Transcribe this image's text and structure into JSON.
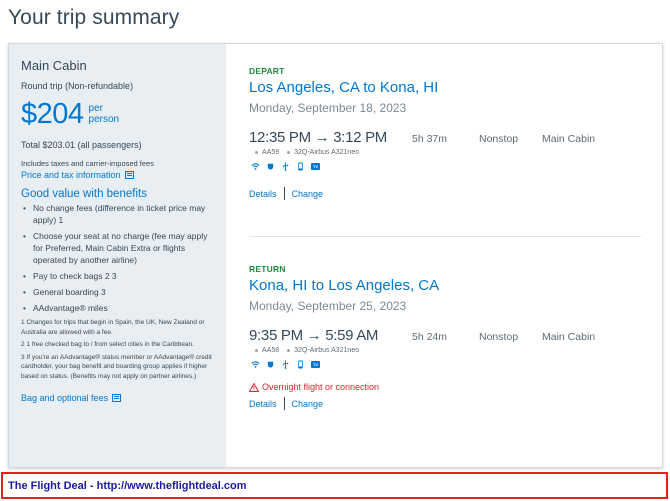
{
  "page": {
    "title": "Your trip summary"
  },
  "sidebar": {
    "cabin": "Main Cabin",
    "trip_type": "Round trip (Non-refundable)",
    "price": "$204",
    "per_line1": "per",
    "per_line2": "person",
    "total": "Total $203.01 (all passengers)",
    "includes": "Includes taxes and carrier-imposed fees",
    "price_tax_link": "Price and tax information",
    "benefits_title": "Good value with benefits",
    "benefits": [
      "No change fees (difference in ticket price may apply) 1",
      "Choose your seat at no charge (fee may apply for Preferred, Main Cabin Extra or flights operated by another airline)",
      "Pay to check bags 2 3",
      "General boarding 3",
      "AAdvantage® miles"
    ],
    "notes": [
      "1 Changes for trips that begin in Spain, the UK, New Zealand or Australia are allowed with a fee.",
      "2 1 free checked bag to / from select cities in the Caribbean.",
      "3 If you're an AAdvantage® status member or AAdvantage® credit cardholder, your bag benefit and boarding group applies if higher based on status. (Benefits may not apply on partner airlines.)"
    ],
    "bag_link": "Bag and optional fees"
  },
  "depart": {
    "label": "DEPART",
    "route": "Los Angeles, CA to Kona, HI",
    "date": "Monday, September 18, 2023",
    "times": "12:35 PM  →  3:12 PM",
    "duration": "5h 37m",
    "stops": "Nonstop",
    "cabin": "Main Cabin",
    "flight": "AA59",
    "aircraft": "32Q-Airbus A321neo",
    "details": "Details",
    "change": "Change"
  },
  "return": {
    "label": "RETURN",
    "route": "Kona, HI to Los Angeles, CA",
    "date": "Monday, September 25, 2023",
    "times": "9:35 PM  →  5:59 AM",
    "duration": "5h 24m",
    "stops": "Nonstop",
    "cabin": "Main Cabin",
    "flight": "AA58",
    "aircraft": "32Q-Airbus A321neo",
    "warning": "Overnight flight or connection",
    "details": "Details",
    "change": "Change"
  },
  "amenity_icons": [
    "wifi-icon",
    "power-icon",
    "usb-icon",
    "phone-icon",
    "tv-icon"
  ],
  "amenity_tv_label": "TV",
  "footer": {
    "text": "The Flight Deal - http://www.theflightdeal.com"
  },
  "colors": {
    "accent": "#0078d2",
    "green": "#1b8a3b",
    "warning": "#d9272d",
    "footer_border": "#e1251b",
    "footer_text": "#1a1aa6"
  }
}
